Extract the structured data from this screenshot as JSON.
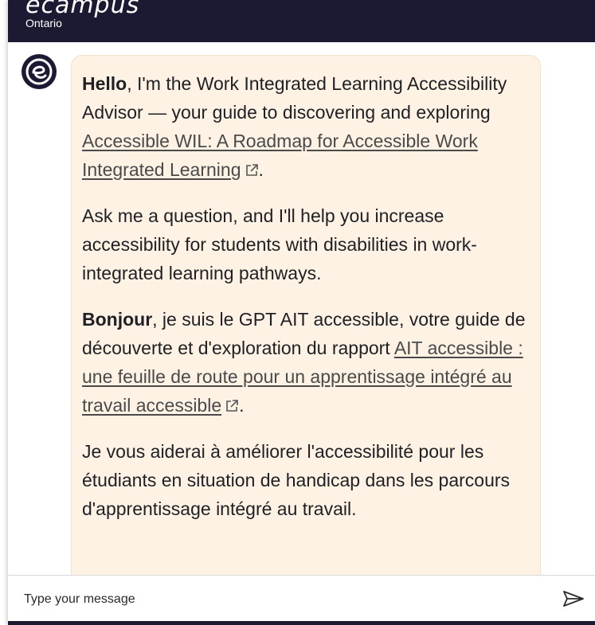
{
  "header": {
    "logo_word": "ecampus",
    "logo_sub": "Ontario"
  },
  "message": {
    "p1_bold": "Hello",
    "p1_text": ", I'm the Work Integrated Learning Accessibility Advisor — your guide to discovering and exploring ",
    "p1_link": "Accessible WIL: A Roadmap for Accessible Work Integrated Learning",
    "p1_end": ".",
    "p2": "Ask me a question, and I'll help you increase accessibility for students with disabilities in work-integrated learning pathways.",
    "p3_bold": "Bonjour",
    "p3_text": ", je suis le GPT AIT accessible, votre guide de découverte et d'exploration du rapport ",
    "p3_link": "AIT accessible : une feuille de route pour un apprentissage intégré au travail accessible",
    "p3_end": ".",
    "p4": "Je vous aiderai à améliorer l'accessibilité pour les étudiants en situation de handicap dans les parcours d'apprentissage intégré au travail."
  },
  "composer": {
    "placeholder": "Type your message",
    "value": ""
  },
  "icons": {
    "avatar": "ecampus-e-logo-icon",
    "external": "external-link-icon",
    "send": "send-icon"
  },
  "colors": {
    "header_bg": "#1c1a33",
    "bubble_bg": "#fdf2e4",
    "text": "#1f1f24"
  }
}
